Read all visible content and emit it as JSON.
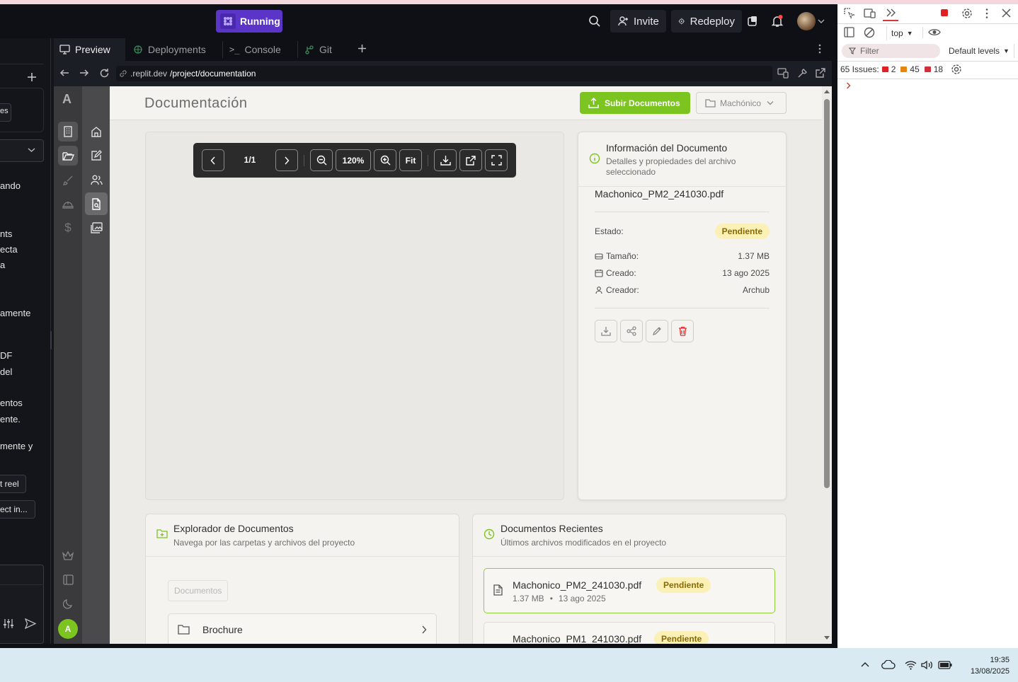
{
  "replit": {
    "run_status": "Running",
    "invite_label": "Invite",
    "redeploy_label": "Redeploy",
    "tabs": [
      {
        "label": "Preview",
        "icon": "monitor-icon"
      },
      {
        "label": "Deployments",
        "icon": "deployments-icon"
      },
      {
        "label": "Console",
        "icon": "terminal-icon"
      },
      {
        "label": "Git",
        "icon": "git-icon"
      }
    ],
    "url_prefix": ".replit.dev",
    "url_path": "/project/documentation"
  },
  "agent_panel": {
    "fragments": [
      "es",
      "ando",
      "nts",
      "ecta",
      "a",
      "amente",
      "DF",
      "del",
      "entos",
      "ente.",
      "mente y",
      "t reel",
      "ect in..."
    ]
  },
  "app": {
    "sidebar_letter": "A",
    "user_initial": "A",
    "page_title": "Documentación",
    "upload_label": "Subir Documentos",
    "project_select": "Machónico",
    "viewer": {
      "page_indicator": "1/1",
      "zoom": "120%",
      "fit_label": "Fit"
    },
    "info": {
      "title": "Información del Documento",
      "subtitle": "Detalles y propiedades del archivo seleccionado",
      "filename": "Machonico_PM2_241030.pdf",
      "status_label": "Estado:",
      "status_value": "Pendiente",
      "size_label": "Tamaño:",
      "size_value": "1.37 MB",
      "created_label": "Creado:",
      "created_value": "13 ago 2025",
      "creator_label": "Creador:",
      "creator_value": "Archub"
    },
    "explorer": {
      "title": "Explorador de Documentos",
      "subtitle": "Navega por las carpetas y archivos del proyecto",
      "breadcrumb": "Documentos",
      "folders": [
        "Brochure"
      ]
    },
    "recent": {
      "title": "Documentos Recientes",
      "subtitle": "Últimos archivos modificados en el proyecto",
      "items": [
        {
          "name": "Machonico_PM2_241030.pdf",
          "status": "Pendiente",
          "size": "1.37 MB",
          "separator": "•",
          "date": "13 ago 2025"
        },
        {
          "name": "Machonico_PM1_241030.pdf",
          "status": "Pendiente"
        }
      ]
    }
  },
  "devtools": {
    "context": "top",
    "filter_placeholder": "Filter",
    "levels": "Default levels",
    "issues_label": "65 Issues:",
    "errors": "2",
    "warnings": "45",
    "infos": "18"
  },
  "taskbar": {
    "time": "19:35",
    "date": "13/08/2025"
  },
  "colors": {
    "accent_green": "#7cc420",
    "running_purple": "#5b35c7",
    "badge_yellow": "#fbf0b5"
  }
}
